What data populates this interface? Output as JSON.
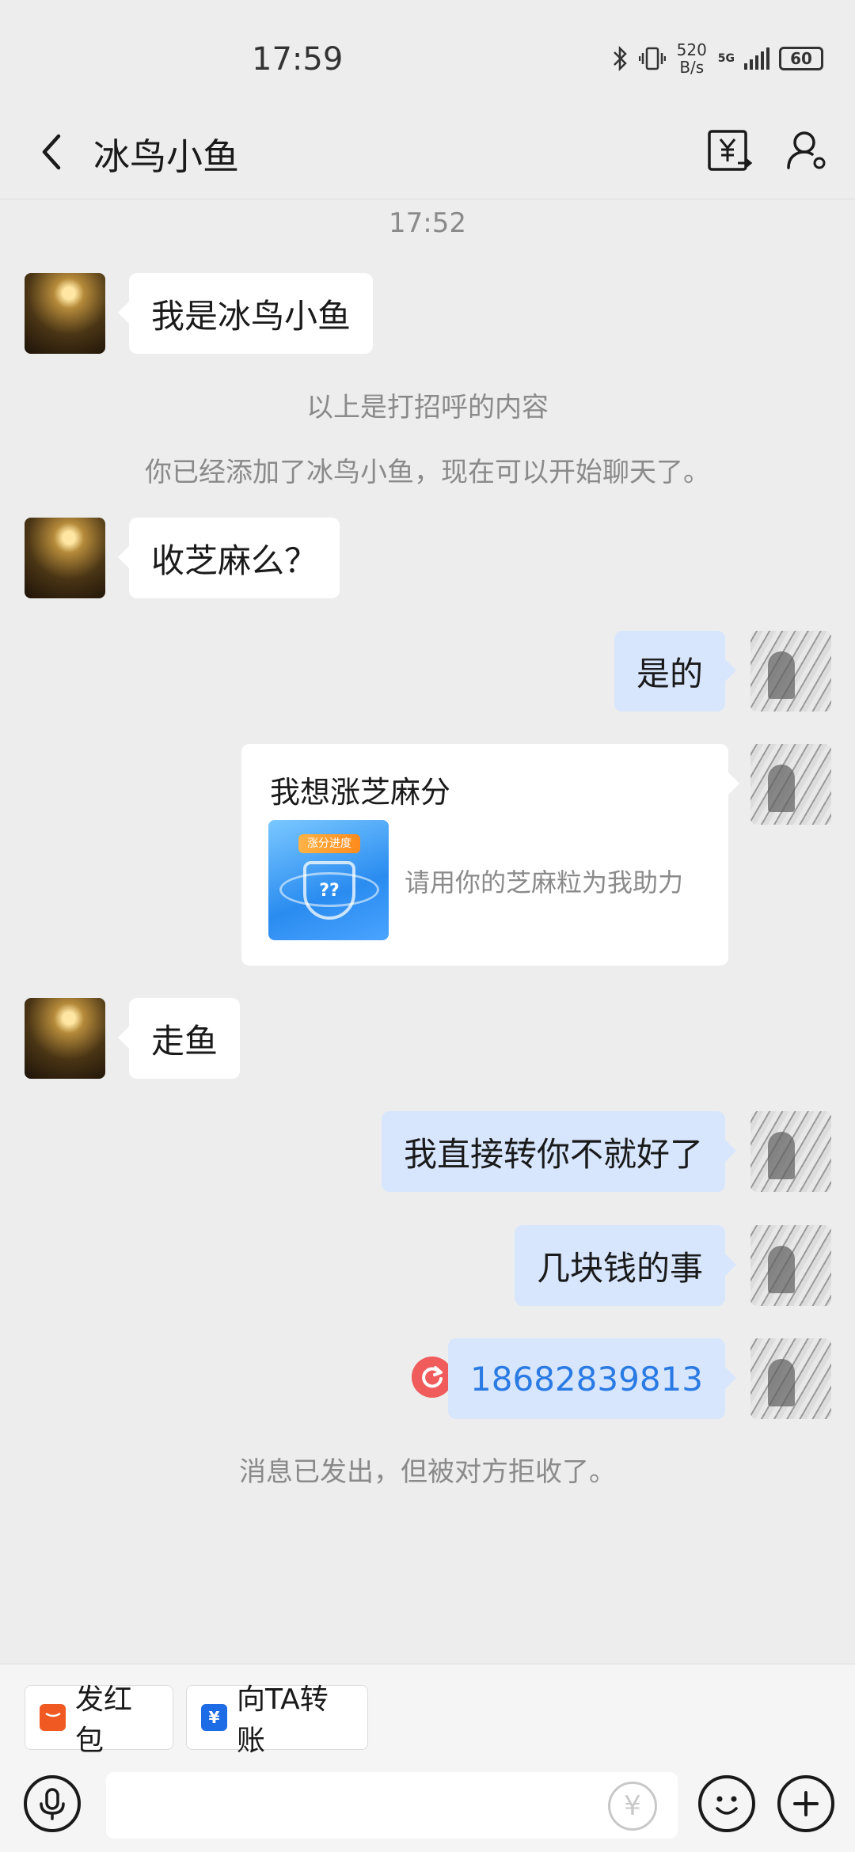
{
  "status_bar": {
    "time": "17:59",
    "net_speed_top": "520",
    "net_speed_bottom": "B/s",
    "network": "5G",
    "battery": "60"
  },
  "header": {
    "title": "冰鸟小鱼"
  },
  "chat": {
    "timestamp": "17:52",
    "msg_greeting": "我是冰鸟小鱼",
    "system_greeting_note": "以上是打招呼的内容",
    "system_added_note": "你已经添加了冰鸟小鱼，现在可以开始聊天了。",
    "msg_left_2": "收芝麻么？",
    "msg_right_1": "是的",
    "card": {
      "title": "我想涨芝麻分",
      "thumb_badge": "涨分进度",
      "thumb_mark": "??",
      "description": "请用你的芝麻粒为我助力"
    },
    "msg_left_3": "走鱼",
    "msg_right_2": "我直接转你不就好了",
    "msg_right_3": "几块钱的事",
    "msg_right_4": "18682839813",
    "system_rejected_note": "消息已发出，但被对方拒收了。"
  },
  "bottom_bar": {
    "red_packet_label": "发红包",
    "transfer_label": "向TA转账",
    "transfer_icon_glyph": "¥",
    "input_placeholder": ""
  },
  "colors": {
    "background": "#ededed",
    "bubble_right": "#d7e6fd",
    "bubble_left": "#ffffff",
    "link_blue": "#2a7ae4",
    "resend_red": "#f05b5b",
    "red_packet": "#f05a22",
    "transfer_blue": "#1e6be6"
  },
  "icons": {
    "back": "chevron-left-icon",
    "transfer": "yuan-transfer-icon",
    "profile": "person-settings-icon",
    "voice": "microphone-icon",
    "emoji": "smiley-icon",
    "more": "plus-icon",
    "resend": "refresh-icon"
  }
}
